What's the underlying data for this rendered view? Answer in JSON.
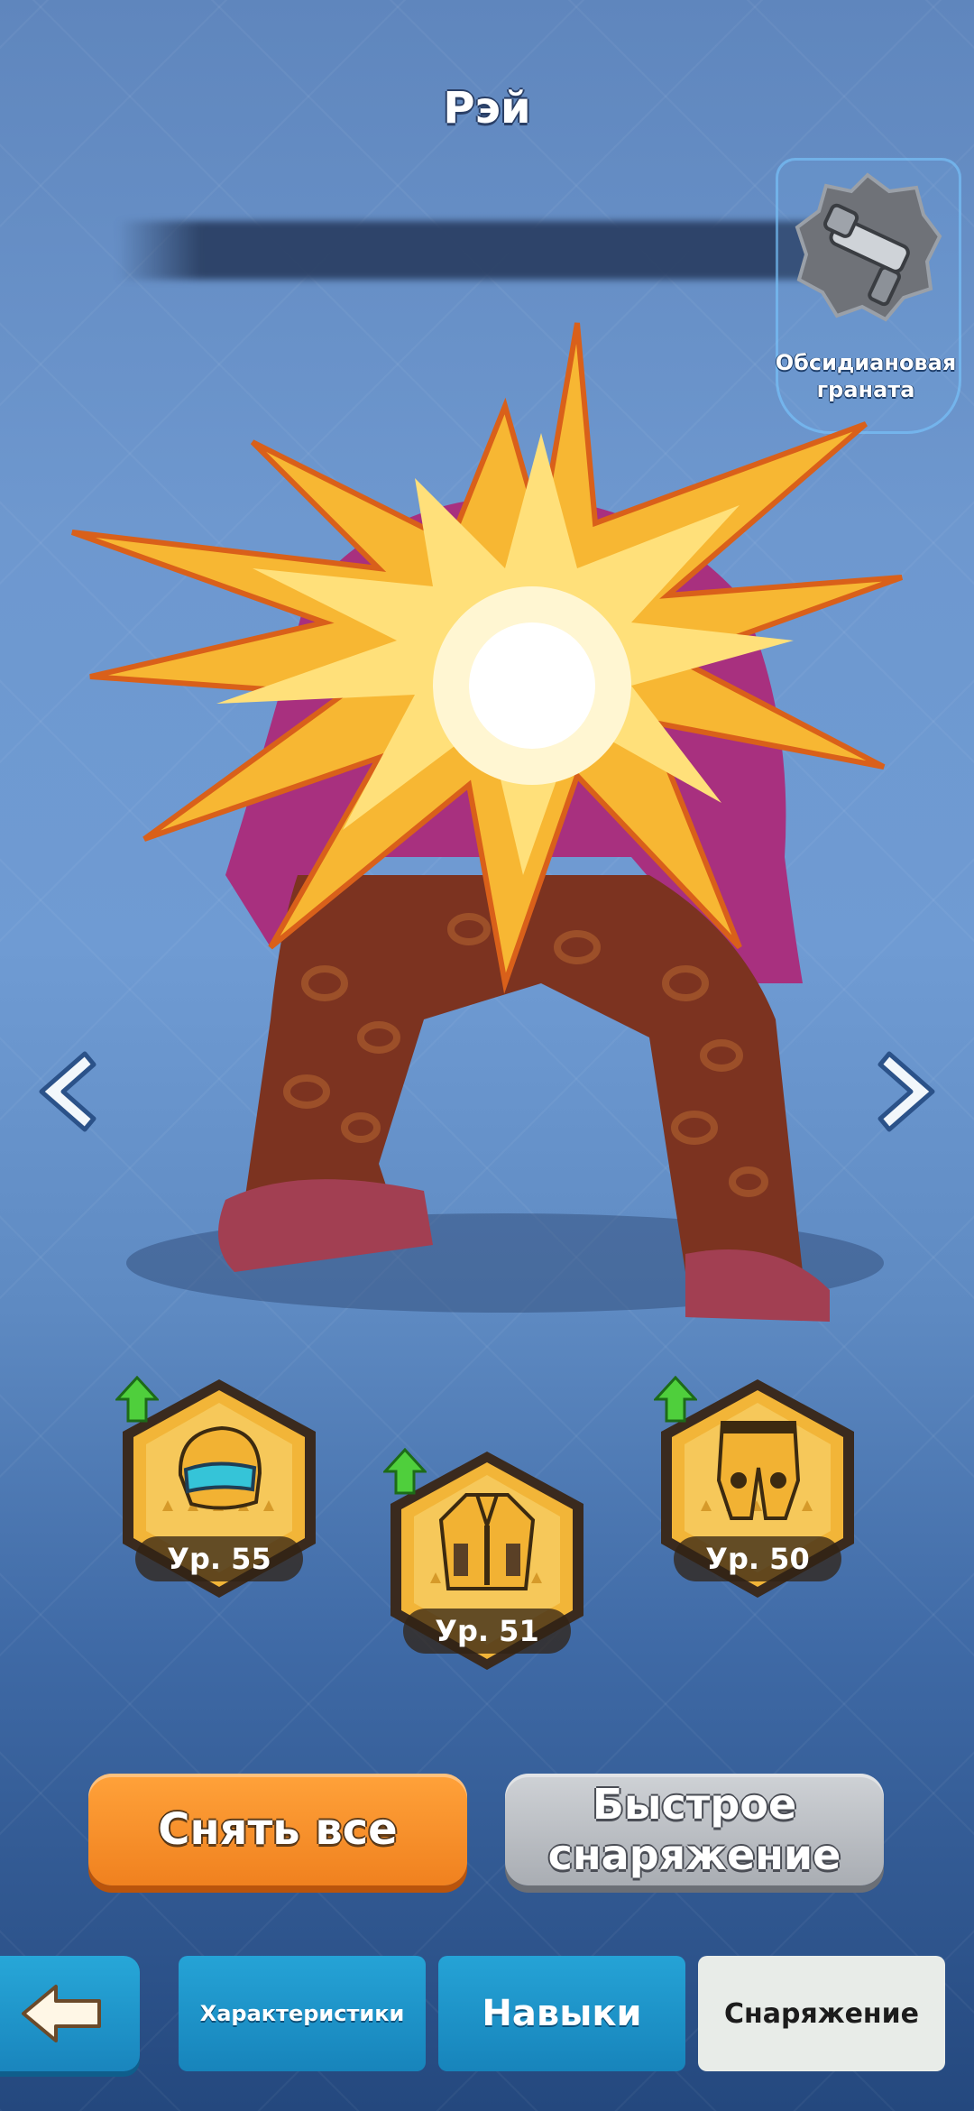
{
  "header": {
    "title": "Рэй"
  },
  "grenade": {
    "label": "Обсидиановая граната",
    "icon": "grenade-launcher-icon"
  },
  "gear": [
    {
      "slot": "helmet",
      "icon": "helmet-icon",
      "level": "Ур. 55",
      "upgrade_available": true
    },
    {
      "slot": "jacket",
      "icon": "jacket-icon",
      "level": "Ур. 51",
      "upgrade_available": true
    },
    {
      "slot": "pants",
      "icon": "pants-icon",
      "level": "Ур. 50",
      "upgrade_available": true
    }
  ],
  "actions": {
    "unequip_all": "Снять все",
    "quick_equip_line1": "Быстрое",
    "quick_equip_line2": "снаряжение"
  },
  "tabs": {
    "stats": "Характеристики",
    "skills": "Навыки",
    "equipment": "Снаряжение",
    "active": "equipment"
  },
  "colors": {
    "accent_orange": "#f0811f",
    "tab_blue": "#1f95c9",
    "gear_gold": "#f2b538"
  }
}
